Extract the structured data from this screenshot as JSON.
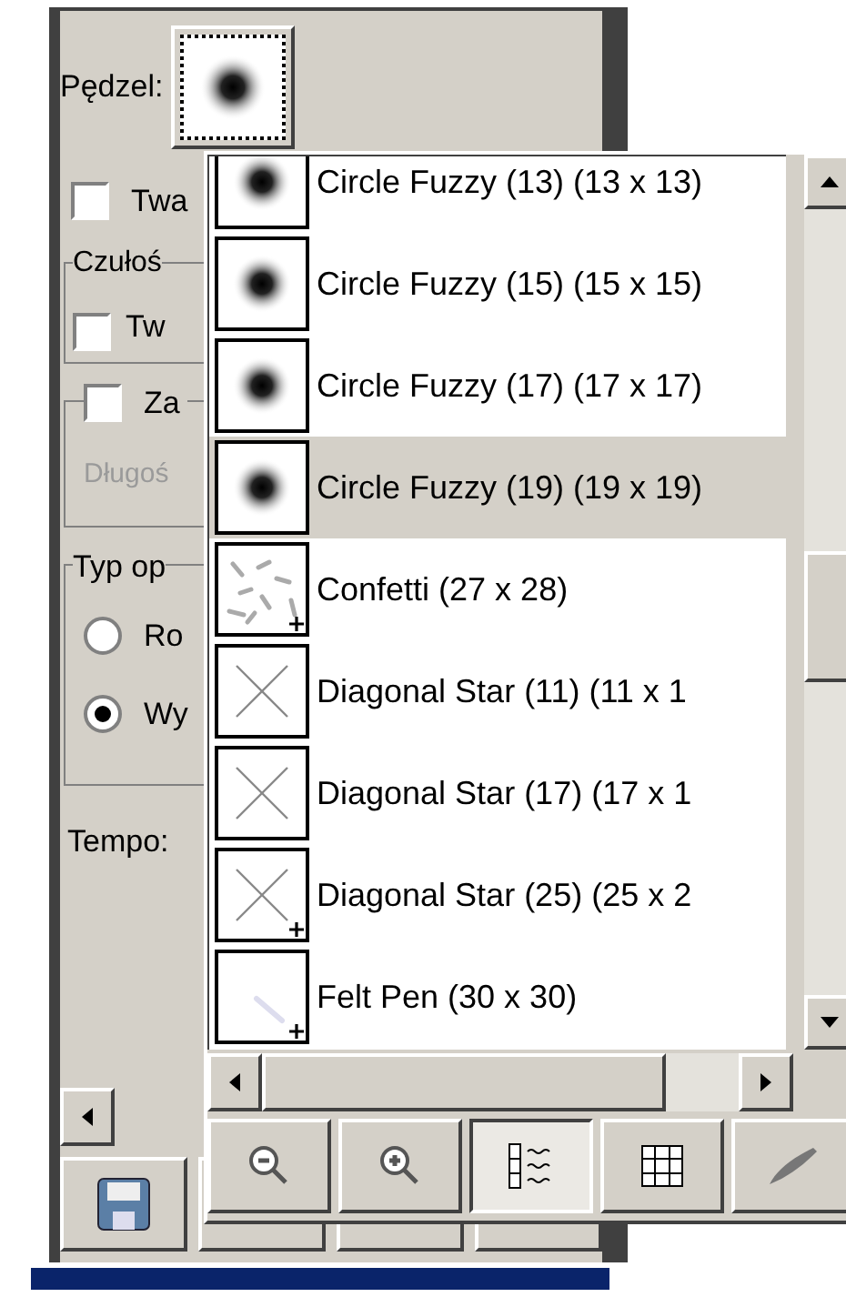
{
  "tool_options": {
    "brush_label": "Pędzel:",
    "pressure_checkbox": {
      "label": "Twa",
      "checked": false
    },
    "sensitivity_group": {
      "title": "Czułoś",
      "checkbox": {
        "label": "Tw",
        "checked": false
      }
    },
    "fade_group": {
      "checkbox": {
        "label": "Za",
        "checked": false
      },
      "length_label": "Długoś",
      "disabled": true
    },
    "type_group": {
      "title": "Typ op",
      "radios": [
        {
          "label": "Ro",
          "selected": false
        },
        {
          "label": "Wy",
          "selected": true
        }
      ]
    },
    "rate_label": "Tempo:"
  },
  "brush_popup": {
    "brushes": [
      {
        "name": "Circle Fuzzy (13) (13 x 13)",
        "kind": "fuzzy",
        "selected": false,
        "scaled": false
      },
      {
        "name": "Circle Fuzzy (15) (15 x 15)",
        "kind": "fuzzy",
        "selected": false,
        "scaled": false
      },
      {
        "name": "Circle Fuzzy (17) (17 x 17)",
        "kind": "fuzzy",
        "selected": false,
        "scaled": false
      },
      {
        "name": "Circle Fuzzy (19) (19 x 19)",
        "kind": "fuzzy",
        "selected": true,
        "scaled": false
      },
      {
        "name": "Confetti (27 x 28)",
        "kind": "confetti",
        "selected": false,
        "scaled": true
      },
      {
        "name": "Diagonal Star (11) (11 x 1",
        "kind": "star",
        "selected": false,
        "scaled": false
      },
      {
        "name": "Diagonal Star (17) (17 x 1",
        "kind": "star",
        "selected": false,
        "scaled": false
      },
      {
        "name": "Diagonal Star (25) (25 x 2",
        "kind": "star",
        "selected": false,
        "scaled": true
      },
      {
        "name": "Felt Pen (30 x 30)",
        "kind": "pen",
        "selected": false,
        "scaled": true
      }
    ],
    "view_modes": [
      {
        "kind": "list",
        "selected": true
      },
      {
        "kind": "grid",
        "selected": false
      }
    ]
  }
}
